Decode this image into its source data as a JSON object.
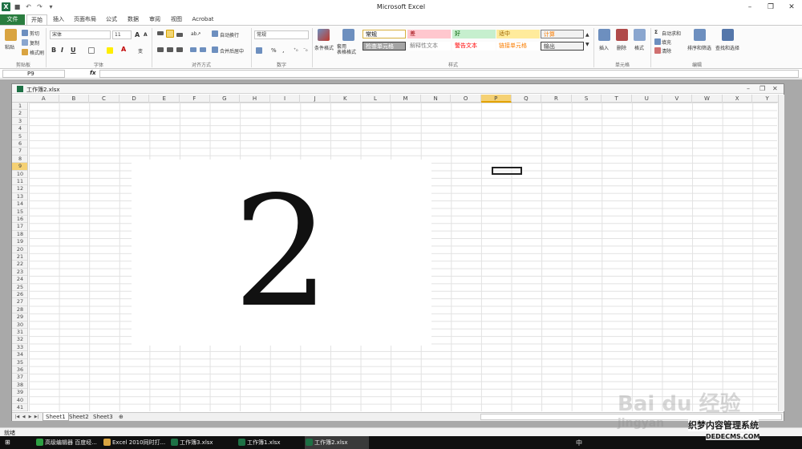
{
  "window": {
    "title": "Microsoft Excel",
    "qat": {
      "excel_icon": "X",
      "undo": "↶",
      "redo": "↷",
      "dropdown": "▾"
    }
  },
  "tabs": [
    "文件",
    "开始",
    "插入",
    "页面布局",
    "公式",
    "数据",
    "审阅",
    "视图",
    "Acrobat"
  ],
  "ribbon": {
    "clipboard": {
      "paste": "粘贴",
      "cut": "剪切",
      "copy": "复制",
      "format_painter": "格式刷",
      "label": "剪贴板"
    },
    "font": {
      "name": "宋体",
      "size": "11",
      "bold": "B",
      "italic": "I",
      "underline": "U",
      "grow": "A",
      "shrink": "A",
      "color": "A",
      "phonetic": "变",
      "label": "字体"
    },
    "alignment": {
      "wrap": "自动换行",
      "merge": "合并后居中",
      "label": "对齐方式"
    },
    "number": {
      "format": "常规",
      "percent": "%",
      "comma": ",",
      "label": "数字"
    },
    "styles": {
      "conditional": "条件格式",
      "table": "套用\n表格格式",
      "label": "样式",
      "cells": [
        {
          "text": "常规",
          "bg": "#ffffff",
          "fg": "#000000",
          "border": "#d8b040"
        },
        {
          "text": "差",
          "bg": "#ffc7ce",
          "fg": "#9c0006",
          "border": ""
        },
        {
          "text": "好",
          "bg": "#c6efce",
          "fg": "#006100",
          "border": ""
        },
        {
          "text": "适中",
          "bg": "#ffeb9c",
          "fg": "#9c6500",
          "border": ""
        },
        {
          "text": "计算",
          "bg": "#f2f2f2",
          "fg": "#fa7d00",
          "border": "#7f7f7f"
        },
        {
          "text": "检查单元格",
          "bg": "#a5a5a5",
          "fg": "#ffffff",
          "border": "#3f3f3f"
        },
        {
          "text": "解释性文本",
          "bg": "#ffffff",
          "fg": "#7f7f7f",
          "border": ""
        },
        {
          "text": "警告文本",
          "bg": "#ffffff",
          "fg": "#ff0000",
          "border": ""
        },
        {
          "text": "链接单元格",
          "bg": "#ffffff",
          "fg": "#fa7d00",
          "border": ""
        },
        {
          "text": "输出",
          "bg": "#f2f2f2",
          "fg": "#3f3f3f",
          "border": "#3f3f3f"
        }
      ]
    },
    "cells": {
      "insert": "插入",
      "delete": "删除",
      "format": "格式",
      "label": "单元格"
    },
    "editing": {
      "autosum": "自动求和",
      "fill": "填充",
      "clear": "清除",
      "sort": "排序和筛选",
      "find": "查找和选择",
      "label": "编辑"
    }
  },
  "formula_bar": {
    "name_box": "P9",
    "fx": "fx"
  },
  "workbook": {
    "title": "工作簿2.xlsx",
    "selected_col": "P",
    "selected_row": "9",
    "columns": [
      "A",
      "B",
      "C",
      "D",
      "E",
      "F",
      "G",
      "H",
      "I",
      "J",
      "K",
      "L",
      "M",
      "N",
      "O",
      "P",
      "Q",
      "R",
      "S",
      "T",
      "U",
      "V",
      "W",
      "X",
      "Y"
    ],
    "rows": [
      "1",
      "2",
      "3",
      "4",
      "5",
      "6",
      "7",
      "8",
      "9",
      "10",
      "11",
      "12",
      "13",
      "14",
      "15",
      "16",
      "17",
      "18",
      "19",
      "20",
      "21",
      "22",
      "23",
      "24",
      "25",
      "26",
      "27",
      "28",
      "29",
      "30",
      "31",
      "32",
      "33",
      "34",
      "35",
      "36",
      "37",
      "38",
      "39",
      "40",
      "41"
    ],
    "digit": "2",
    "sheets": [
      "Sheet1",
      "Sheet2",
      "Sheet3"
    ]
  },
  "status": "就绪",
  "taskbar": {
    "items": [
      "高级编辑器 百度经...",
      "Excel 2010同时打...",
      "工作簿3.xlsx",
      "工作簿1.xlsx",
      "工作簿2.xlsx"
    ],
    "tray": "中"
  },
  "watermarks": {
    "baidu": "Bai du 经验",
    "jingyan": "jingyan",
    "site": "织梦内容管理系统",
    "domain": "DEDECMS.COM"
  }
}
